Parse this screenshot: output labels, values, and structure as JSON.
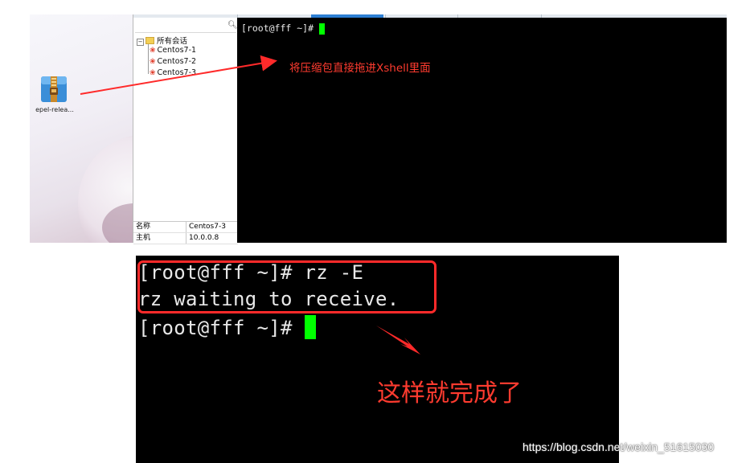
{
  "desktop": {
    "file_label": "epel-relea..."
  },
  "sidebar": {
    "root_label": "所有会话",
    "sessions": [
      "Centos7-1",
      "Centos7-2",
      "Centos7-3"
    ],
    "properties": [
      {
        "key": "名称",
        "value": "Centos7-3"
      },
      {
        "key": "主机",
        "value": "10.0.0.8"
      }
    ]
  },
  "terminal_top": {
    "prompt": "[root@fff ~]# "
  },
  "annotation": {
    "drag_hint": "将压缩包直接拖进Xshell里面",
    "done": "这样就完成了"
  },
  "terminal_bottom": {
    "lines": [
      "[root@fff ~]# rz -E",
      "rz waiting to receive.",
      "[root@fff ~]# "
    ]
  },
  "watermark": "https://blog.csdn.net/weixin_51615030",
  "colors": {
    "annotation_red": "#ff3b2f",
    "cursor_green": "#00ff00",
    "terminal_bg": "#000000"
  }
}
